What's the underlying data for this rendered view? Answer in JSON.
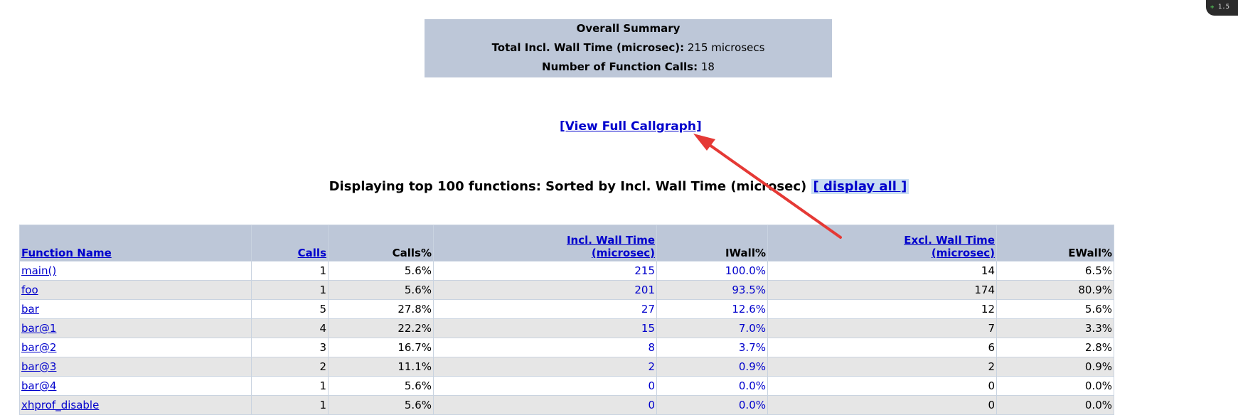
{
  "summary": {
    "title": "Overall Summary",
    "wall_label": "Total Incl. Wall Time (microsec):",
    "wall_value": "215 microsecs",
    "calls_label": "Number of Function Calls:",
    "calls_value": "18"
  },
  "callgraph_link": "[View Full Callgraph]",
  "display": {
    "text": "Displaying top 100 functions: Sorted by Incl. Wall Time (microsec)",
    "display_all": "[ display all ]"
  },
  "table": {
    "headers": {
      "function_name": "Function Name",
      "calls": "Calls",
      "calls_pct": "Calls%",
      "incl_wall_1": "Incl. Wall Time",
      "incl_wall_2": "(microsec)",
      "iwall_pct": "IWall%",
      "excl_wall_1": "Excl. Wall Time",
      "excl_wall_2": "(microsec)",
      "ewall_pct": "EWall%"
    },
    "rows": [
      {
        "name": "main()",
        "calls": "1",
        "calls_pct": "5.6%",
        "incl": "215",
        "iwall": "100.0%",
        "excl": "14",
        "ewall": "6.5%"
      },
      {
        "name": "foo",
        "calls": "1",
        "calls_pct": "5.6%",
        "incl": "201",
        "iwall": "93.5%",
        "excl": "174",
        "ewall": "80.9%"
      },
      {
        "name": "bar",
        "calls": "5",
        "calls_pct": "27.8%",
        "incl": "27",
        "iwall": "12.6%",
        "excl": "12",
        "ewall": "5.6%"
      },
      {
        "name": "bar@1",
        "calls": "4",
        "calls_pct": "22.2%",
        "incl": "15",
        "iwall": "7.0%",
        "excl": "7",
        "ewall": "3.3%"
      },
      {
        "name": "bar@2",
        "calls": "3",
        "calls_pct": "16.7%",
        "incl": "8",
        "iwall": "3.7%",
        "excl": "6",
        "ewall": "2.8%"
      },
      {
        "name": "bar@3",
        "calls": "2",
        "calls_pct": "11.1%",
        "incl": "2",
        "iwall": "0.9%",
        "excl": "2",
        "ewall": "0.9%"
      },
      {
        "name": "bar@4",
        "calls": "1",
        "calls_pct": "5.6%",
        "incl": "0",
        "iwall": "0.0%",
        "excl": "0",
        "ewall": "0.0%"
      },
      {
        "name": "xhprof_disable",
        "calls": "1",
        "calls_pct": "5.6%",
        "incl": "0",
        "iwall": "0.0%",
        "excl": "0",
        "ewall": "0.0%"
      }
    ]
  },
  "corner_badge": {
    "icon": "plus-icon",
    "text": "1.5"
  },
  "colors": {
    "header_bg": "#bdc7d8",
    "link": "#0000cc",
    "arrow": "#e53935",
    "zebra": "#e6e6e6"
  }
}
